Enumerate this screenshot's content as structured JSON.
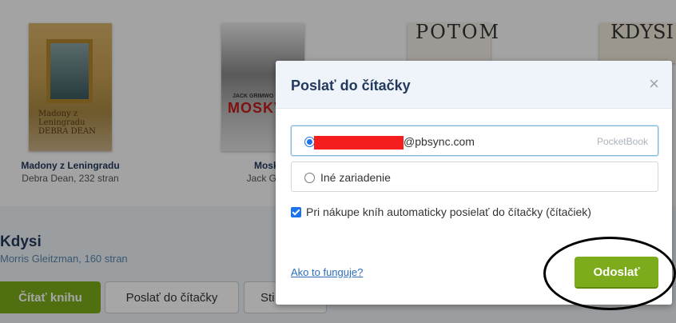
{
  "books": [
    {
      "title": "Madony z Leningradu",
      "author_pages": "Debra Dean, 232 stran",
      "cover_text": "Madony z Leningradu DEBRA DEAN"
    },
    {
      "title": "Moskva",
      "author_pages": "Jack Grimw",
      "cover_text_author": "JACK GRIMWO",
      "cover_text_title": "MOSKVA"
    },
    {
      "cover_text": "POTOM"
    },
    {
      "cover_text": "KDYSI"
    }
  ],
  "detail": {
    "title": "Kdysi",
    "subtitle": "Morris Gleitzman, 160 stran",
    "read_button": "Čítať knihu",
    "send_button": "Poslať do čítačky",
    "third_button": "Sti"
  },
  "modal": {
    "title": "Poslať do čítačky",
    "close": "×",
    "devices": [
      {
        "email_suffix": "@pbsync.com",
        "tag": "PocketBook",
        "selected": true
      },
      {
        "label": "Iné zariadenie",
        "selected": false
      }
    ],
    "auto_send_label": "Pri nákupe kníh automaticky posielať do čítačky (čítačiek)",
    "auto_send_checked": true,
    "help_link": "Ako to funguje?",
    "submit": "Odoslať"
  },
  "colors": {
    "accent_green": "#7cab1b",
    "title_navy": "#23395d",
    "link_blue": "#2a6ebb"
  }
}
